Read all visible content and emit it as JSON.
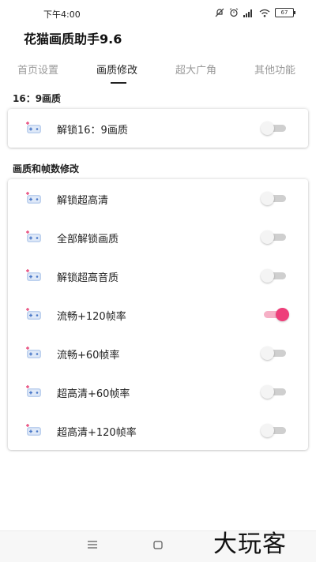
{
  "status_bar": {
    "time": "下午4:00",
    "battery": "67"
  },
  "app": {
    "title": "花猫画质助手9.6"
  },
  "tabs": [
    {
      "label": "首页设置",
      "active": false
    },
    {
      "label": "画质修改",
      "active": true
    },
    {
      "label": "超大广角",
      "active": false
    },
    {
      "label": "其他功能",
      "active": false
    }
  ],
  "sections": [
    {
      "title": "16：9画质",
      "items": [
        {
          "label": "解锁16：9画质",
          "enabled": false
        }
      ]
    },
    {
      "title": "画质和帧数修改",
      "items": [
        {
          "label": "解锁超高清",
          "enabled": false
        },
        {
          "label": "全部解锁画质",
          "enabled": false
        },
        {
          "label": "解锁超高音质",
          "enabled": false
        },
        {
          "label": "流畅+120帧率",
          "enabled": true
        },
        {
          "label": "流畅+60帧率",
          "enabled": false
        },
        {
          "label": "超高清+60帧率",
          "enabled": false
        },
        {
          "label": "超高清+120帧率",
          "enabled": false
        }
      ]
    }
  ],
  "colors": {
    "accent": "#ee3f7a",
    "accent_track": "#f6b0c6",
    "off_track": "#cfcfcf"
  },
  "watermark": "大玩客"
}
